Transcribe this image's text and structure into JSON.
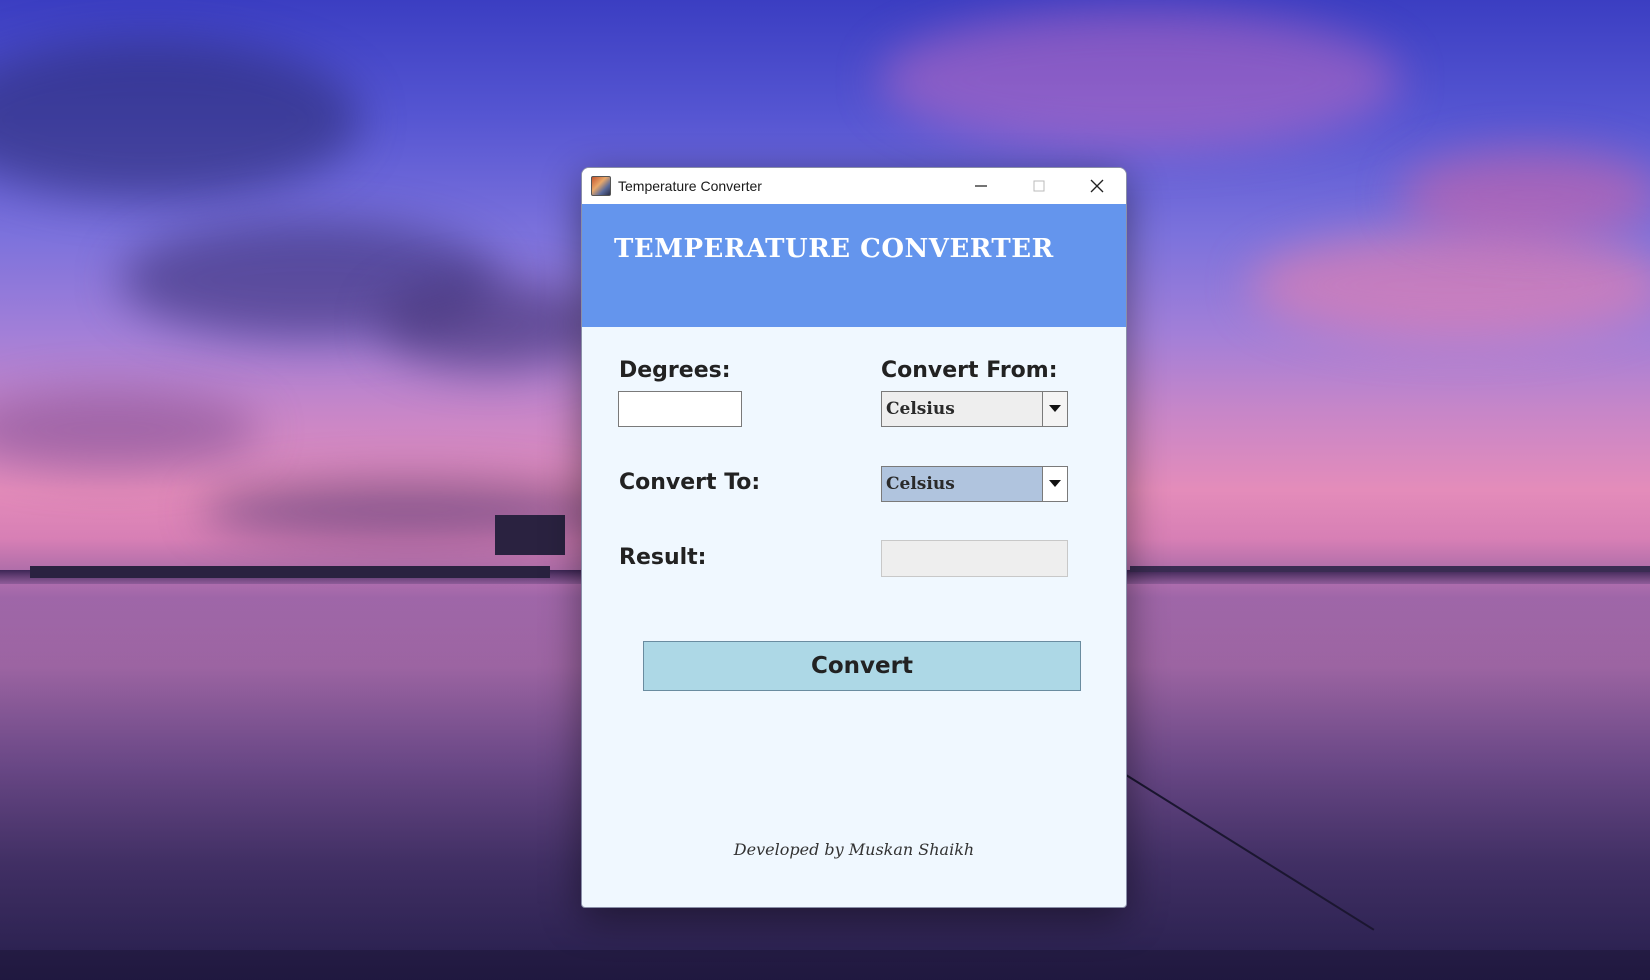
{
  "window": {
    "title": "Temperature Converter",
    "controls": {
      "minimize_icon": "minimize-icon",
      "maximize_icon": "maximize-icon",
      "close_icon": "close-icon"
    }
  },
  "header": {
    "title": "TEMPERATURE CONVERTER",
    "background_color": "#6495ed"
  },
  "form": {
    "degrees_label": "Degrees:",
    "degrees_value": "",
    "convert_from_label": "Convert From:",
    "convert_from_selected": "Celsius",
    "convert_to_label": "Convert To:",
    "convert_to_selected": "Celsius",
    "result_label": "Result:",
    "result_value": ""
  },
  "actions": {
    "convert_label": "Convert",
    "convert_color": "#add8e6"
  },
  "footer": {
    "credit": "Developed by Muskan Shaikh"
  },
  "colors": {
    "body_background": "#f0f8ff",
    "convert_to_combo": "#b0c4de"
  }
}
